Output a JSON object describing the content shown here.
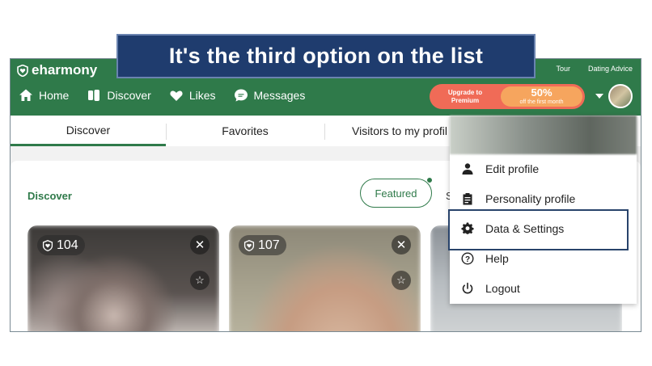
{
  "caption": "It's the third option on the list",
  "header": {
    "logo_text": "eharmony",
    "top_links": [
      "Tour",
      "Dating Advice"
    ],
    "nav": [
      {
        "label": "Home",
        "icon": "home-icon"
      },
      {
        "label": "Discover",
        "icon": "discover-icon"
      },
      {
        "label": "Likes",
        "icon": "heart-icon"
      },
      {
        "label": "Messages",
        "icon": "chat-icon"
      }
    ],
    "upgrade": {
      "line1": "Upgrade to",
      "line2": "Premium",
      "percent": "50%",
      "sub": "off the first month"
    }
  },
  "tabs": [
    {
      "label": "Discover",
      "active": true
    },
    {
      "label": "Favorites",
      "active": false
    },
    {
      "label": "Visitors to my profil",
      "active": false
    }
  ],
  "main": {
    "title": "Discover",
    "filter_label": "Featured",
    "cut_label": "S",
    "cards": [
      {
        "score": "104"
      },
      {
        "score": "107"
      },
      {
        "score": ""
      }
    ]
  },
  "dropdown": {
    "items": [
      {
        "label": "Edit profile",
        "icon": "person-icon"
      },
      {
        "label": "Personality profile",
        "icon": "clipboard-icon"
      },
      {
        "label": "Data & Settings",
        "icon": "gear-icon"
      },
      {
        "label": "Help",
        "icon": "help-icon"
      },
      {
        "label": "Logout",
        "icon": "power-icon"
      }
    ],
    "highlighted_item": "Data & Settings"
  },
  "colors": {
    "brand_green": "#2f7a4a",
    "caption_bg": "#1f3c6e",
    "highlight_border": "#28436b",
    "upgrade": "#f06b57"
  }
}
